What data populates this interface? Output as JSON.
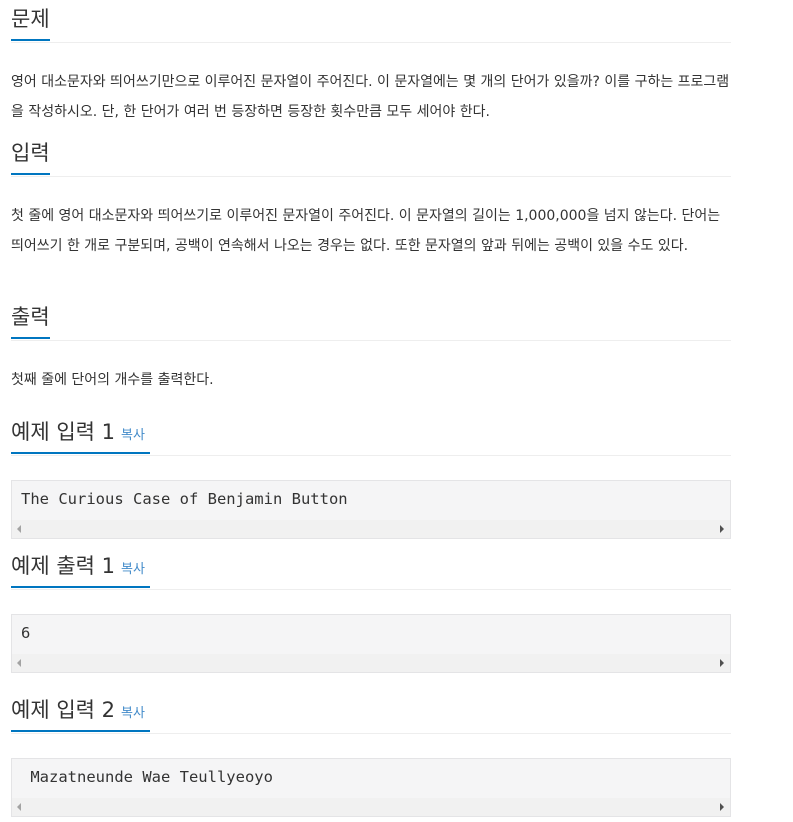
{
  "problem": {
    "title": "문제",
    "text": "영어 대소문자와 띄어쓰기만으로 이루어진 문자열이 주어진다. 이 문자열에는 몇 개의 단어가 있을까? 이를 구하는 프로그램을 작성하시오. 단, 한 단어가 여러 번 등장하면 등장한 횟수만큼 모두 세어야 한다."
  },
  "input": {
    "title": "입력",
    "text": "첫 줄에 영어 대소문자와 띄어쓰기로 이루어진 문자열이 주어진다. 이 문자열의 길이는 1,000,000을 넘지 않는다. 단어는 띄어쓰기 한 개로 구분되며, 공백이 연속해서 나오는 경우는 없다. 또한 문자열의 앞과 뒤에는 공백이 있을 수도 있다."
  },
  "output": {
    "title": "출력",
    "text": "첫째 줄에 단어의 개수를 출력한다."
  },
  "samples": [
    {
      "title": "예제 입력 1",
      "copy_label": "복사",
      "content": "The Curious Case of Benjamin Button"
    },
    {
      "title": "예제 출력 1",
      "copy_label": "복사",
      "content": "6"
    },
    {
      "title": "예제 입력 2",
      "copy_label": "복사",
      "content": " Mazatneunde Wae Teullyeoyo"
    }
  ],
  "icons": {
    "scroll_left": "arrow-left-icon",
    "scroll_right": "arrow-right-icon"
  },
  "colors": {
    "accent": "#0076c0",
    "copy_link": "#428bca",
    "pre_background": "#f5f5f6"
  }
}
